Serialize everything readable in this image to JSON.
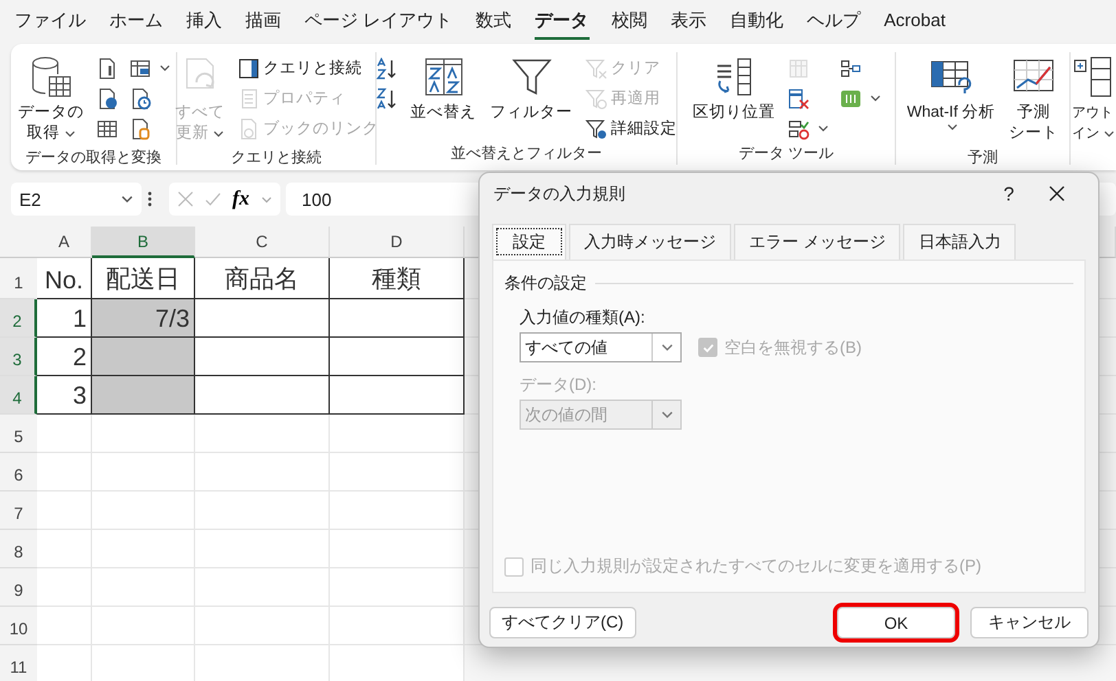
{
  "menu": [
    {
      "label": "ファイル",
      "selected": false
    },
    {
      "label": "ホーム",
      "selected": false
    },
    {
      "label": "挿入",
      "selected": false
    },
    {
      "label": "描画",
      "selected": false
    },
    {
      "label": "ページ レイアウト",
      "selected": false
    },
    {
      "label": "数式",
      "selected": false
    },
    {
      "label": "データ",
      "selected": true
    },
    {
      "label": "校閲",
      "selected": false
    },
    {
      "label": "表示",
      "selected": false
    },
    {
      "label": "自動化",
      "selected": false
    },
    {
      "label": "ヘルプ",
      "selected": false
    },
    {
      "label": "Acrobat",
      "selected": false
    }
  ],
  "ribbon": [
    {
      "label": "データの取得と変換",
      "items": [
        {
          "kind": "large",
          "lines": [
            "データの",
            "取得"
          ],
          "disabled": false,
          "dropdown": true
        },
        {
          "kind": "stack",
          "items": [
            {
              "kind": "icon",
              "disabled": false,
              "dropdown": false
            },
            {
              "kind": "icon",
              "disabled": false,
              "dropdown": false
            },
            {
              "kind": "icon",
              "disabled": false,
              "dropdown": false
            }
          ]
        },
        {
          "kind": "stack",
          "items": [
            {
              "kind": "icon",
              "disabled": false,
              "dropdown": true
            },
            {
              "kind": "icon",
              "disabled": false,
              "dropdown": false
            },
            {
              "kind": "icon",
              "disabled": false,
              "dropdown": false
            }
          ]
        }
      ]
    },
    {
      "label": "クエリと接続",
      "items": [
        {
          "kind": "large",
          "lines": [
            "すべて",
            "更新"
          ],
          "disabled": true,
          "dropdown": true
        },
        {
          "kind": "stack",
          "items": [
            {
              "kind": "small",
              "label": "クエリと接続",
              "disabled": false,
              "dropdown": false
            },
            {
              "kind": "small",
              "label": "プロパティ",
              "disabled": true,
              "dropdown": false
            },
            {
              "kind": "small",
              "label": "ブックのリンク",
              "disabled": true,
              "dropdown": false
            }
          ]
        }
      ]
    },
    {
      "label": "並べ替えとフィルター",
      "items": [
        {
          "kind": "stack",
          "items": [
            {
              "kind": "icon",
              "disabled": false,
              "dropdown": false
            },
            {
              "kind": "icon",
              "disabled": false,
              "dropdown": false
            }
          ]
        },
        {
          "kind": "large",
          "lines": [
            "並べ替え"
          ],
          "disabled": false,
          "dropdown": false
        },
        {
          "kind": "large",
          "lines": [
            "フィルター"
          ],
          "disabled": false,
          "dropdown": false
        },
        {
          "kind": "stack",
          "items": [
            {
              "kind": "small",
              "label": "クリア",
              "disabled": true,
              "dropdown": false
            },
            {
              "kind": "small",
              "label": "再適用",
              "disabled": true,
              "dropdown": false
            },
            {
              "kind": "small",
              "label": "詳細設定",
              "disabled": false,
              "dropdown": false
            }
          ]
        }
      ]
    },
    {
      "label": "データ ツール",
      "items": [
        {
          "kind": "large",
          "lines": [
            "区切り位置"
          ],
          "disabled": false,
          "dropdown": false
        },
        {
          "kind": "stack",
          "items": [
            {
              "kind": "icon",
              "disabled": true,
              "dropdown": false
            },
            {
              "kind": "icon",
              "disabled": false,
              "dropdown": false
            },
            {
              "kind": "icon",
              "disabled": false,
              "dropdown": true
            }
          ]
        },
        {
          "kind": "stack",
          "items": [
            {
              "kind": "icon",
              "disabled": false,
              "dropdown": false
            },
            {
              "kind": "icon",
              "disabled": false,
              "dropdown": true
            }
          ]
        }
      ]
    },
    {
      "label": "予測",
      "items": [
        {
          "kind": "large",
          "lines": [
            "What-If 分析"
          ],
          "disabled": false,
          "dropdown": true
        },
        {
          "kind": "large",
          "lines": [
            "予測",
            "シート"
          ],
          "disabled": false,
          "dropdown": false
        }
      ]
    },
    {
      "items": [
        {
          "kind": "large",
          "lines": [
            "アウト",
            "イン"
          ],
          "disabled": false,
          "dropdown": true
        }
      ]
    }
  ],
  "formula_bar": {
    "name_box": "E2",
    "function_button": "fx",
    "value": "100"
  },
  "sheet": {
    "columns": [
      {
        "label": "A",
        "selected": false
      },
      {
        "label": "B",
        "selected": true
      },
      {
        "label": "C",
        "selected": false
      },
      {
        "label": "D",
        "selected": false
      }
    ],
    "rows": [
      {
        "header": "1",
        "selected": false,
        "bordered": true,
        "cells": [
          {
            "text": "No.",
            "shaded": false
          },
          {
            "text": "配送日",
            "shaded": false
          },
          {
            "text": "商品名",
            "shaded": false
          },
          {
            "text": "種類",
            "shaded": false
          }
        ]
      },
      {
        "header": "2",
        "selected": true,
        "bordered": true,
        "cells": [
          {
            "text": "1",
            "shaded": false
          },
          {
            "text": "7/3",
            "shaded": true
          }
        ]
      },
      {
        "header": "3",
        "selected": true,
        "bordered": true,
        "cells": [
          {
            "text": "2",
            "shaded": false
          },
          {
            "shaded": true
          }
        ]
      },
      {
        "header": "4",
        "selected": true,
        "bordered": true,
        "cells": [
          {
            "text": "3",
            "shaded": false
          },
          {
            "shaded": true
          }
        ]
      },
      {
        "header": "5",
        "selected": false,
        "bordered": false
      },
      {
        "header": "6",
        "selected": false,
        "bordered": false
      },
      {
        "header": "7",
        "selected": false,
        "bordered": false
      },
      {
        "header": "8",
        "selected": false,
        "bordered": false
      },
      {
        "header": "9",
        "selected": false,
        "bordered": false
      },
      {
        "header": "10",
        "selected": false,
        "bordered": false
      },
      {
        "header": "11",
        "selected": false,
        "bordered": false
      }
    ]
  },
  "dialog": {
    "title": "データの入力規則",
    "help": "?",
    "tabs": [
      {
        "label": "設定",
        "selected": true
      },
      {
        "label": "入力時メッセージ",
        "selected": false
      },
      {
        "label": "エラー メッセージ",
        "selected": false
      },
      {
        "label": "日本語入力",
        "selected": false
      }
    ],
    "section": "条件の設定",
    "type_label": "入力値の種類(A):",
    "type_value": "すべての値",
    "type_disabled": false,
    "ignore_blank": {
      "label": "空白を無視する(B)",
      "checked": true,
      "disabled": true
    },
    "data_label": "データ(D):",
    "data_value": "次の値の間",
    "data_disabled": true,
    "apply_all": {
      "label": "同じ入力規則が設定されたすべてのセルに変更を適用する(P)",
      "checked": false,
      "disabled": true
    },
    "buttons": [
      {
        "label": "すべてクリア(C)",
        "highlighted": false
      },
      {
        "label": "OK",
        "highlighted": true
      },
      {
        "label": "キャンセル",
        "highlighted": false
      }
    ]
  }
}
